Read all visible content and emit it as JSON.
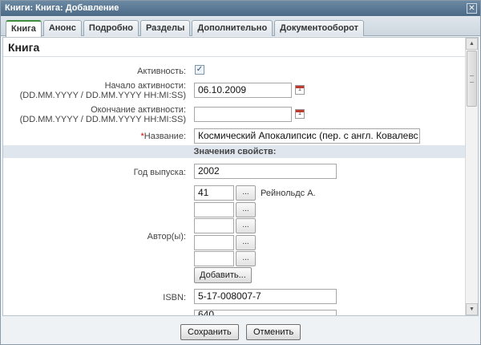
{
  "window": {
    "title": "Книги: Книга: Добавление",
    "close": "✕"
  },
  "tabs": [
    {
      "label": "Книга"
    },
    {
      "label": "Анонс"
    },
    {
      "label": "Подробно"
    },
    {
      "label": "Разделы"
    },
    {
      "label": "Дополнительно"
    },
    {
      "label": "Документооборот"
    }
  ],
  "section": {
    "title": "Книга"
  },
  "fields": {
    "activity": {
      "label": "Активность:",
      "checked": "✓"
    },
    "start": {
      "label_line1": "Начало активности:",
      "label_line2": "(DD.MM.YYYY / DD.MM.YYYY HH:MI:SS)",
      "value": "06.10.2009"
    },
    "end": {
      "label_line1": "Окончание активности:",
      "label_line2": "(DD.MM.YYYY / DD.MM.YYYY HH:MI:SS)",
      "value": ""
    },
    "name": {
      "required_mark": "*",
      "label": "Название:",
      "value": "Космический Апокалипсис (пер. с англ. Ковалевс"
    }
  },
  "properties": {
    "header": "Значения свойств:",
    "year": {
      "label": "Год выпуска:",
      "value": "2002"
    },
    "authors": {
      "label": "Автор(ы):",
      "rows": [
        {
          "value": "41",
          "name": "Рейнольдс А."
        },
        {
          "value": "",
          "name": ""
        },
        {
          "value": "",
          "name": ""
        },
        {
          "value": "",
          "name": ""
        },
        {
          "value": "",
          "name": ""
        }
      ],
      "dots_label": "...",
      "add_label": "Добавить..."
    },
    "isbn": {
      "label": "ISBN:",
      "value": "5-17-008007-7"
    },
    "partial": {
      "value": "640"
    }
  },
  "calendar_glyph": "1",
  "footer": {
    "save_label": "Сохранить",
    "cancel_label": "Отменить"
  },
  "colors": {
    "titlebar": "#5a7895",
    "active_tab_accent": "#3d8d3d",
    "required": "#dd0000"
  }
}
